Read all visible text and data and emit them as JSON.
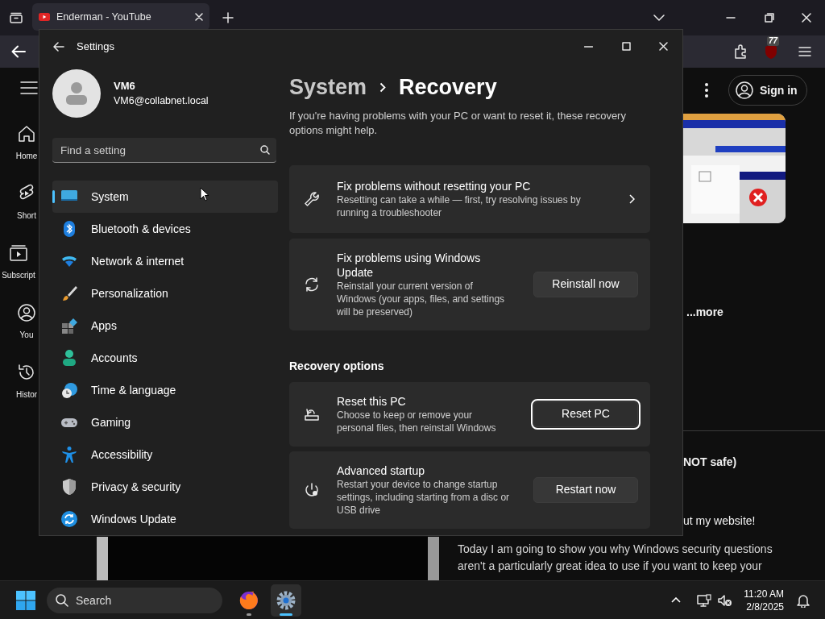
{
  "browser": {
    "tabs": [
      {
        "title": "Enderman - YouTube",
        "selected": true
      }
    ],
    "extension_badge": "77"
  },
  "youtube": {
    "rail": [
      {
        "label": "Home"
      },
      {
        "label": "Short"
      },
      {
        "label": "Subscript"
      },
      {
        "label": "You"
      },
      {
        "label": "Histor"
      }
    ],
    "sign_in": "Sign in",
    "more": "...more",
    "snippets": [
      "NOT safe)",
      "ut my website!"
    ],
    "description": [
      "Today I am going to show you why Windows security questions",
      "aren't a particularly great idea to use if you want to keep your"
    ]
  },
  "settings": {
    "title": "Settings",
    "user": {
      "name": "VM6",
      "email": "VM6@collabnet.local"
    },
    "search": {
      "placeholder": "Find a setting"
    },
    "nav": [
      {
        "label": "System",
        "selected": true
      },
      {
        "label": "Bluetooth & devices",
        "selected": false
      },
      {
        "label": "Network & internet",
        "selected": false
      },
      {
        "label": "Personalization",
        "selected": false
      },
      {
        "label": "Apps",
        "selected": false
      },
      {
        "label": "Accounts",
        "selected": false
      },
      {
        "label": "Time & language",
        "selected": false
      },
      {
        "label": "Gaming",
        "selected": false
      },
      {
        "label": "Accessibility",
        "selected": false
      },
      {
        "label": "Privacy & security",
        "selected": false
      },
      {
        "label": "Windows Update",
        "selected": false
      }
    ],
    "breadcrumb": [
      "System",
      "Recovery"
    ],
    "intro": "If you're having problems with your PC or want to reset it, these recovery options might help.",
    "cards": [
      {
        "kind": "link",
        "title": "Fix problems without resetting your PC",
        "description": "Resetting can take a while — first, try resolving issues by running a troubleshooter"
      },
      {
        "kind": "button",
        "title": "Fix problems using Windows Update",
        "description": "Reinstall your current version of Windows (your apps, files, and settings will be preserved)",
        "button": {
          "label": "Reinstall now",
          "focused": false
        }
      }
    ],
    "section": {
      "heading": "Recovery options",
      "cards": [
        {
          "kind": "button",
          "title": "Reset this PC",
          "description": "Choose to keep or remove your personal files, then reinstall Windows",
          "button": {
            "label": "Reset PC",
            "focused": true
          }
        },
        {
          "kind": "button",
          "title": "Advanced startup",
          "description": "Restart your device to change startup settings, including starting from a disc or USB drive",
          "button": {
            "label": "Restart now",
            "focused": false
          }
        }
      ]
    }
  },
  "taskbar": {
    "search": {
      "placeholder": "Search"
    },
    "apps": [
      {
        "active": false
      },
      {
        "active": true
      }
    ],
    "clock": {
      "time": "11:20 AM",
      "date": "2/8/2025"
    }
  }
}
